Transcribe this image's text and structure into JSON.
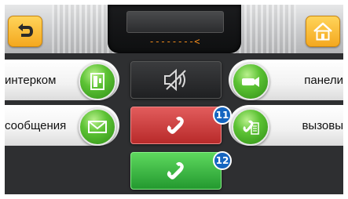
{
  "display": {
    "readout": "--------<"
  },
  "rows": [
    {
      "left_label": "интерком",
      "right_label": "панели"
    },
    {
      "left_label": "сообщения",
      "right_label": "вызовы"
    }
  ],
  "badges": {
    "reject": "11",
    "accept": "12"
  },
  "colors": {
    "accent": "#f4a81f",
    "accept": "#23992f",
    "reject": "#b82a2a",
    "badge": "#1565c0"
  }
}
